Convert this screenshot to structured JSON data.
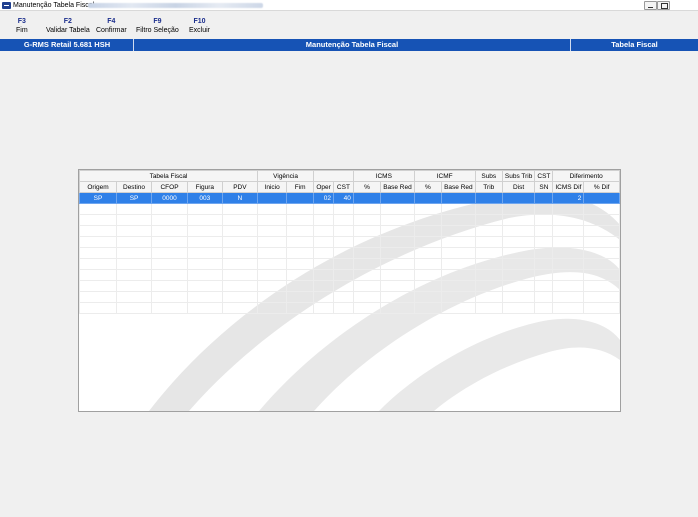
{
  "window": {
    "title": "Manutenção Tabela Fiscal"
  },
  "toolbar": {
    "buttons": [
      {
        "key": "F3",
        "label": "Fim"
      },
      {
        "key": "F2",
        "label": "Validar Tabela"
      },
      {
        "key": "F4",
        "label": "Confirmar"
      },
      {
        "key": "F9",
        "label": "Filtro Seleção"
      },
      {
        "key": "F10",
        "label": "Excluir"
      }
    ]
  },
  "header": {
    "system": "G-RMS Retail 5.681 HSH",
    "screen": "Manutenção Tabela Fiscal",
    "table": "Tabela Fiscal"
  },
  "grid": {
    "groups": {
      "tabela_fiscal": "Tabela Fiscal",
      "vigencia": "Vigência",
      "icms": "ICMS",
      "icmf": "ICMF",
      "subs": "Subs",
      "subs_trib": "Subs Trib",
      "cst": "CST",
      "diferimento": "Diferimento"
    },
    "columns": [
      "Origem",
      "Destino",
      "CFOP",
      "Figura",
      "PDV",
      "Inicio",
      "Fim",
      "Oper",
      "CST",
      "%",
      "Base Red",
      "%",
      "Base Red",
      "Trib",
      "Dist",
      "SN",
      "ICMS Dif",
      "% Dif"
    ],
    "rows": [
      [
        "SP",
        "SP",
        "0000",
        "003",
        "N",
        "",
        "",
        "02",
        "40",
        "",
        "",
        "",
        "",
        "",
        "",
        "",
        "2",
        ""
      ]
    ]
  },
  "colors": {
    "band": "#1653b5",
    "selected_row": "#2f80e8",
    "toolbar_key": "#1a2d8c"
  }
}
